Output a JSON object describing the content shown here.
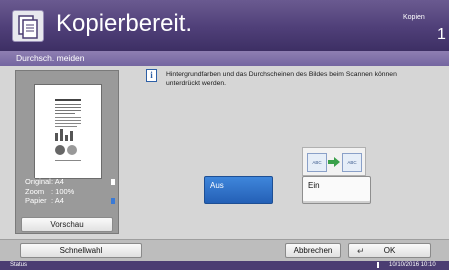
{
  "header": {
    "title": "Kopierbereit.",
    "jobs_label": "Kopien",
    "count": "1",
    "app_icon": "copy-icon"
  },
  "tab": {
    "label": "Durchsch. meiden"
  },
  "preview": {
    "info": [
      {
        "key": "Original",
        "value": ": A4"
      },
      {
        "key": "Zoom",
        "value": ": 100%"
      },
      {
        "key": "Papier",
        "value": ": A4"
      }
    ],
    "button_label": "Vorschau"
  },
  "main": {
    "description": "Hintergrundfarben und das Durchscheinen des Bildes beim Scannen können unterdrückt werden.",
    "abc_left": "ABC",
    "abc_right": "ABC",
    "options": [
      {
        "label": "Aus",
        "selected": true
      },
      {
        "label": "Ein",
        "selected": false
      }
    ]
  },
  "bottom": {
    "quick_setup": "Schnellwahl",
    "cancel": "Abbrechen",
    "ok": "OK"
  },
  "status": {
    "label": "Status",
    "datetime": "10/10/2016  10:10"
  },
  "colors": {
    "header": "#4f3f78",
    "tab": "#8e7fb2",
    "selected": "#2f6fc7"
  }
}
